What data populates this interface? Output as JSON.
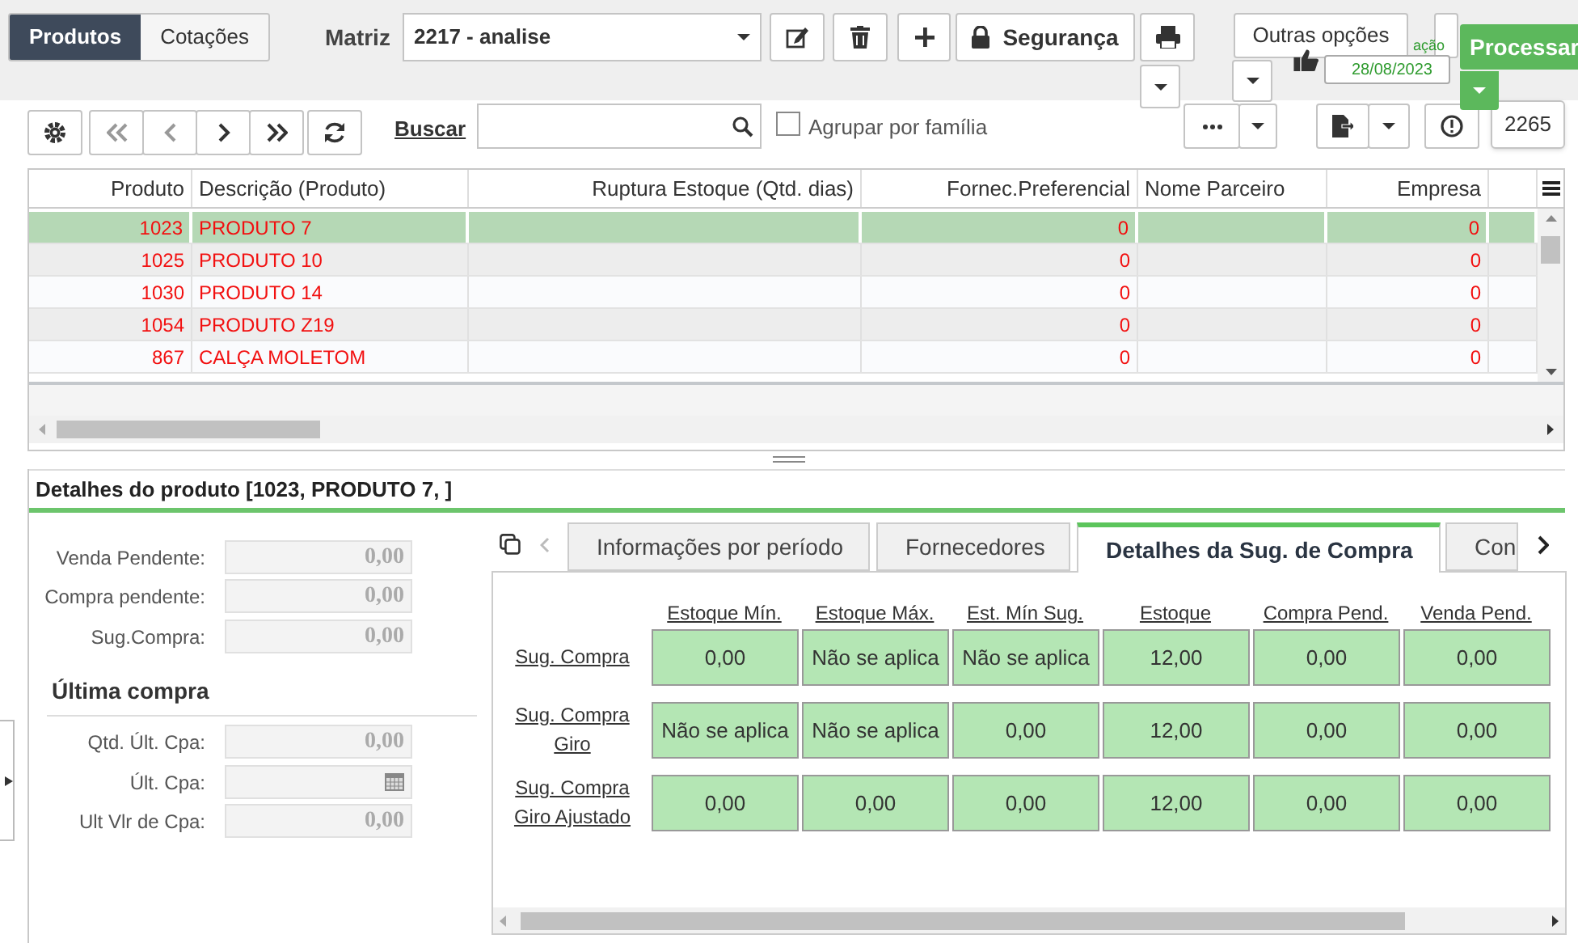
{
  "top_tabs": [
    {
      "label": "Produtos",
      "selected": true
    },
    {
      "label": "Cotações",
      "selected": false
    }
  ],
  "matriz": {
    "label": "Matriz",
    "value": "2217 - analise"
  },
  "security_button": {
    "label": "Segurança"
  },
  "other_options_button": {
    "label": "Outras opções"
  },
  "notification": {
    "text": "ação",
    "date": "28/08/2023"
  },
  "process_button": {
    "label": "Processar"
  },
  "grid_toolbar": {
    "search_label": "Buscar",
    "group_checkbox": {
      "label": "Agrupar por família",
      "checked": false
    },
    "record_count": "2265"
  },
  "table": {
    "columns": [
      "Produto",
      "Descrição (Produto)",
      "Ruptura Estoque (Qtd. dias)",
      "Fornec.Preferencial",
      "Nome Parceiro",
      "Empresa"
    ],
    "rows": [
      {
        "selected": true,
        "cells": [
          "1023",
          "PRODUTO 7",
          "",
          "0",
          "",
          "0"
        ]
      },
      {
        "selected": false,
        "cells": [
          "1025",
          "PRODUTO 10",
          "",
          "0",
          "",
          "0"
        ]
      },
      {
        "selected": false,
        "cells": [
          "1030",
          "PRODUTO 14",
          "",
          "0",
          "",
          "0"
        ]
      },
      {
        "selected": false,
        "cells": [
          "1054",
          "PRODUTO Z19",
          "",
          "0",
          "",
          "0"
        ]
      },
      {
        "selected": false,
        "cells": [
          "867",
          "CALÇA MOLETOM",
          "",
          "0",
          "",
          "0"
        ]
      }
    ]
  },
  "details": {
    "title": "Detalhes do produto [1023, PRODUTO 7, ]",
    "fields": [
      {
        "label": "Venda Pendente:",
        "value": "0,00"
      },
      {
        "label": "Compra pendente:",
        "value": "0,00"
      },
      {
        "label": "Sug.Compra:",
        "value": "0,00"
      }
    ],
    "last_purchase": {
      "title": "Última compra",
      "fields": [
        {
          "kind": "number",
          "label": "Qtd. Últ. Cpa:",
          "value": "0,00"
        },
        {
          "kind": "date",
          "label": "Últ. Cpa:"
        },
        {
          "kind": "number",
          "label": "Ult Vlr de Cpa:",
          "value": "0,00"
        }
      ]
    },
    "tabs": [
      {
        "label": "Informações por período",
        "selected": false
      },
      {
        "label": "Fornecedores",
        "selected": false
      },
      {
        "label": "Detalhes da Sug. de Compra",
        "selected": true
      },
      {
        "label": "Con",
        "selected": false
      }
    ],
    "matrix": {
      "columns": [
        "Estoque Mín.",
        "Estoque Máx.",
        "Est. Mín Sug.",
        "Estoque",
        "Compra Pend.",
        "Venda Pend."
      ],
      "rows": [
        {
          "label": "Sug. Compra",
          "values": [
            "0,00",
            "Não se aplica",
            "Não se aplica",
            "12,00",
            "0,00",
            "0,00"
          ]
        },
        {
          "label": "Sug. Compra Giro",
          "values": [
            "Não se aplica",
            "Não se aplica",
            "0,00",
            "12,00",
            "0,00",
            "0,00"
          ]
        },
        {
          "label": "Sug. Compra Giro Ajustado",
          "values": [
            "0,00",
            "0,00",
            "0,00",
            "12,00",
            "0,00",
            "0,00"
          ]
        }
      ]
    }
  }
}
